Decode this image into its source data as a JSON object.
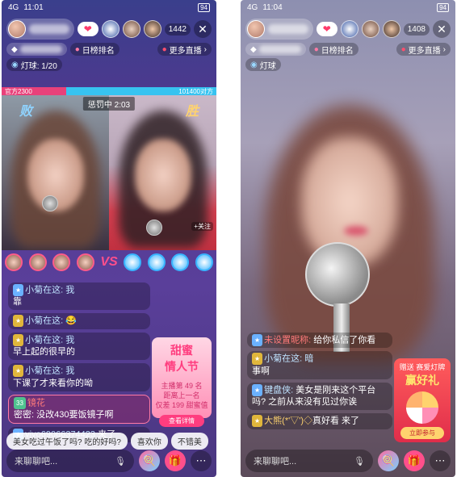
{
  "left": {
    "status": {
      "time": "11:01",
      "signal": "4G",
      "battery": "94"
    },
    "top": {
      "viewer_count": "1442",
      "close": "✕"
    },
    "row2": {
      "rank": "日榜排名",
      "more_live": "更多直播",
      "arrow": "›"
    },
    "row3": {
      "lantern": "灯球: 1/20"
    },
    "pk": {
      "left_score": "官方2300",
      "right_score": "101400对方",
      "timer": "惩罚中 2:03",
      "lose": "败",
      "win": "胜",
      "tag": "+关注"
    },
    "chat": [
      {
        "name": "小菊在这: 我",
        "text": "靠",
        "lvl": ""
      },
      {
        "name": "小菊在这:",
        "text": "😂",
        "lvl": ""
      },
      {
        "name": "小菊在这: 我",
        "text": "早上起的很早的",
        "lvl": ""
      },
      {
        "name": "小菊在这: 我",
        "text": "下课了才来看你的呦",
        "lvl": ""
      },
      {
        "name": "镜花",
        "text": "密密: 没改430要饭镜子啊",
        "lvl": "33"
      },
      {
        "name": "vivo69066374423",
        "text": " 来了",
        "lvl": ""
      }
    ],
    "promo": {
      "title": "甜蜜",
      "title2": "情人节",
      "line1": "主播第 49 名",
      "line2": "距离上一名",
      "line3": "仅差 199 甜蜜值",
      "btn": "查看详情"
    },
    "quick": [
      "美女吃过午饭了吗? 吃的好吗?",
      "喜欢你",
      "不错美"
    ],
    "input_placeholder": "来聊聊吧...",
    "icons": {
      "mic": "mic-icon",
      "candy": "candy-icon",
      "gift": "gift-icon",
      "more": "more-icon"
    }
  },
  "right": {
    "status": {
      "time": "11:04",
      "signal": "4G",
      "battery": "94"
    },
    "top": {
      "viewer_count": "1408",
      "close": "✕"
    },
    "row2": {
      "rank": "日榜排名",
      "more_live": "更多直播",
      "arrow": "›"
    },
    "row3": {
      "lantern": "灯球"
    },
    "chat": [
      {
        "name": "未设置昵称:",
        "text": " 给你私信了你看",
        "lvl": ""
      },
      {
        "name": "小菊在这: 暗",
        "text": "事啊",
        "lvl": ""
      },
      {
        "name": "键盘侠:",
        "text": " 美女是刚来这个平台吗? 之前从来没有见过你诶",
        "lvl": ""
      },
      {
        "name": "大熊(*'▽')◇",
        "text": "真好看 来了",
        "lvl": ""
      }
    ],
    "promo": {
      "top": "赠送 赛爱灯牌",
      "title": "赢好礼",
      "btn": "立即参与"
    },
    "input_placeholder": "来聊聊吧..."
  }
}
